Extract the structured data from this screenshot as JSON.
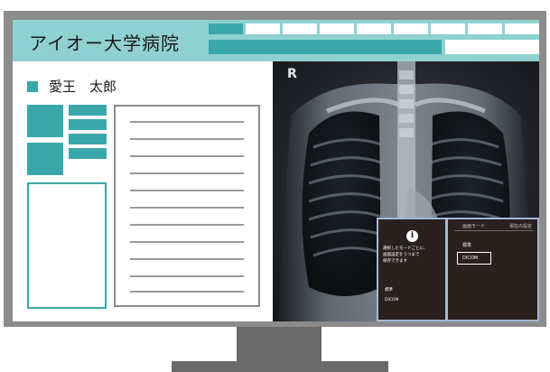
{
  "header": {
    "title": "アイオー大学病院",
    "tab_count": 9
  },
  "patient": {
    "name": "愛王　太郎"
  },
  "document": {
    "line_count": 11
  },
  "xray": {
    "orientation_marker": "R"
  },
  "dialog": {
    "message": "選択したモードごとに、\n画面設定をうつまで\n保存できます",
    "left_option_1": "標準",
    "left_option_2": "DICOM",
    "column_mode": "画面モード",
    "column_current": "現在の設定",
    "mode_standard": "標準",
    "mode_dicom": "DICOM"
  },
  "colors": {
    "accent": "#3aa8aa",
    "header_bg": "#8fd1d0",
    "bezel": "#8c8c8c",
    "dialog_bg": "#2a201d"
  }
}
